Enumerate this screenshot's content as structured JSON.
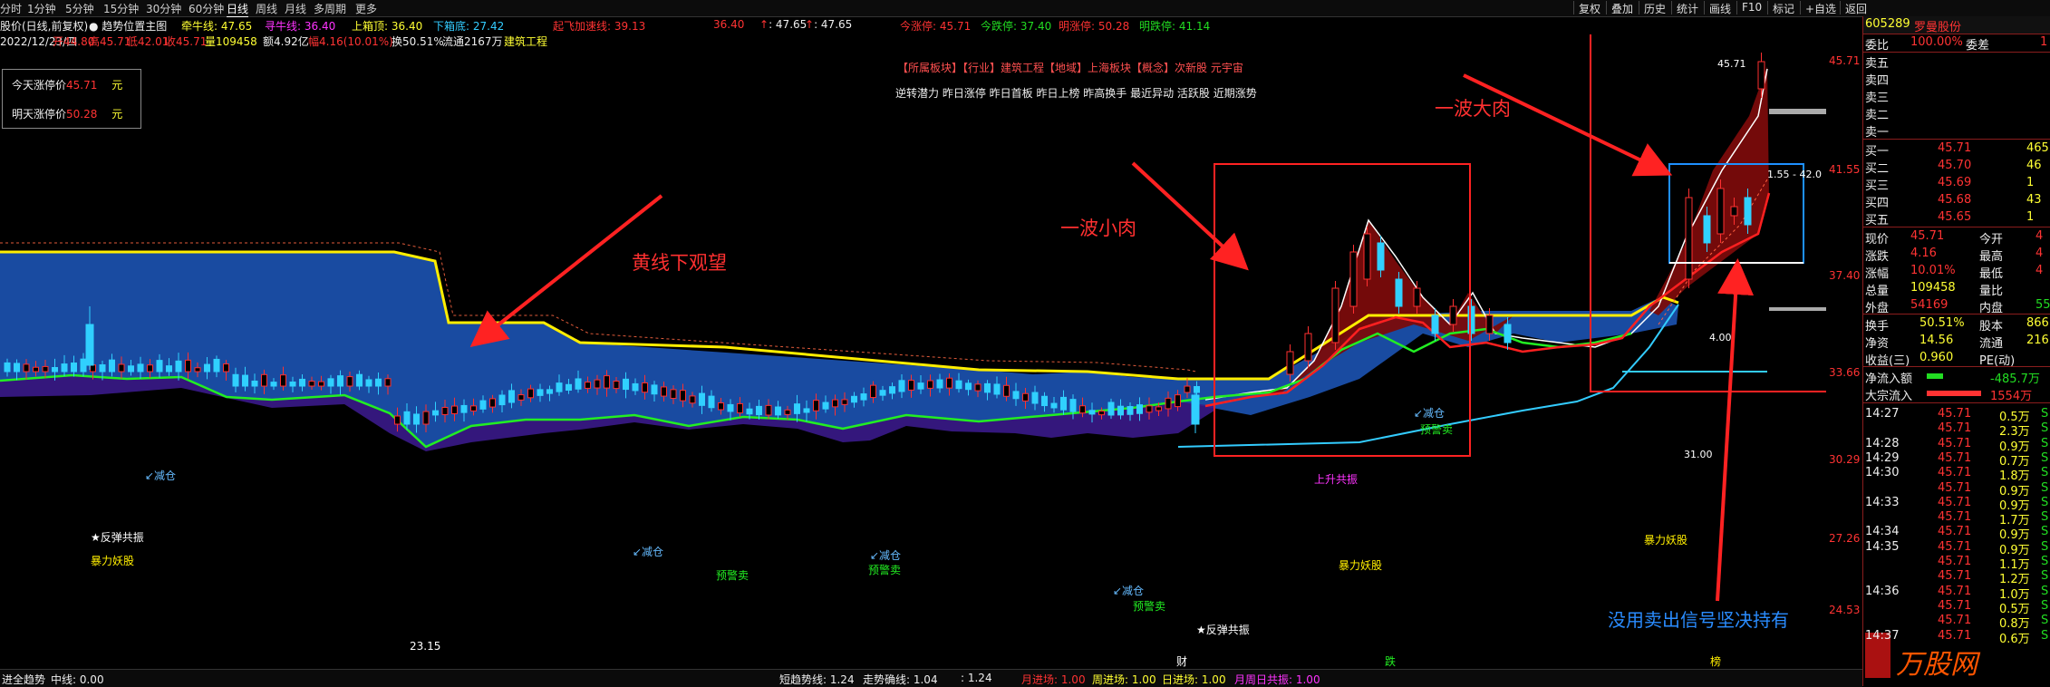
{
  "toolbar": {
    "timeframes": [
      "分时",
      "1分钟",
      "5分钟",
      "15分钟",
      "30分钟",
      "60分钟",
      "日线",
      "周线",
      "月线",
      "多周期",
      "更多"
    ],
    "active_timeframe": "日线",
    "right_buttons": [
      "复权",
      "叠加",
      "历史",
      "统计",
      "画线",
      "F10",
      "标记",
      "+自选",
      "返回"
    ]
  },
  "indicator_line1": {
    "title": "股价(日线,前复权)",
    "sub": "趋势位置主图",
    "items": [
      {
        "label": "牵牛线: 47.65",
        "color": "#ffff33"
      },
      {
        "label": "寻牛线: 36.40",
        "color": "#ff33ff"
      },
      {
        "label": "上箱顶: 36.40",
        "color": "#ffff33"
      },
      {
        "label": "下箱底: 27.42",
        "color": "#33ccff"
      },
      {
        "label": "起飞加速线: 39.13",
        "color": "#ff3333"
      },
      {
        "label": "36.40",
        "color": "#ff3333"
      },
      {
        "label": ": 47.65",
        "color": "#eeeeee"
      },
      {
        "label": ": 47.65",
        "color": "#eeeeee"
      },
      {
        "label": "今涨停: 45.71",
        "color": "#ff3333"
      },
      {
        "label": "今跌停: 37.40",
        "color": "#22dd22"
      },
      {
        "label": "明涨停: 50.28",
        "color": "#ff3333"
      },
      {
        "label": "明跌停: 41.14",
        "color": "#22dd22"
      }
    ]
  },
  "indicator_line2": {
    "date": "2022/12/23/四",
    "open": "开44.80",
    "high": "高45.71",
    "low": "低42.01",
    "close": "收45.71",
    "volume": "量109458",
    "amount": "额4.92亿",
    "change": "幅4.16(10.01%)",
    "turnover": "换50.51%",
    "float": "流通2167万",
    "sector": "建筑工程"
  },
  "limit_box": {
    "today_label": "今天涨停价",
    "today_value": "45.71",
    "today_unit": "元",
    "tomorrow_label": "明天涨停价",
    "tomorrow_value": "50.28",
    "tomorrow_unit": "元"
  },
  "tags": {
    "line1": "【所属板块】【行业】建筑工程【地域】上海板块【概念】次新股 元宇宙",
    "line2": "逆转潜力 昨日涨停 昨日首板 昨日上榜 昨高换手 最近异动 活跃股 近期涨势"
  },
  "annotations": {
    "yellow_line": "黄线下观望",
    "small_wave": "一波小肉",
    "big_wave": "一波大肉",
    "hold": "没用卖出信号坚决持有",
    "reduce_labels": [
      "↙减仓",
      "↙减仓",
      "↙减仓",
      "↙减仓",
      "↙减仓"
    ],
    "warn_labels": [
      "预警卖",
      "预警卖",
      "预警卖",
      "预警卖"
    ],
    "rebound_labels": [
      "★反弹共振",
      "★反弹共振"
    ],
    "monster_labels": [
      "暴力妖股",
      "暴力妖股",
      "暴力妖股"
    ],
    "rise_label": "上升共振",
    "price_marks": {
      "p1": "23.15",
      "p2": "45.71",
      "p3": "4.00",
      "p4": "31.00",
      "p5": "1.55 - 42.0"
    },
    "bottom_marks": {
      "cai": "财",
      "die": "跌",
      "bang": "榜"
    }
  },
  "y_axis": [
    "45.71",
    "41.55",
    "37.40",
    "33.66",
    "30.29",
    "27.26",
    "24.53"
  ],
  "bottom_bar": [
    {
      "label": "进全趋势",
      "color": "#eeeeee"
    },
    {
      "label": "中线: 0.00",
      "color": "#eeeeee"
    },
    {
      "label": "短趋势线: 1.24",
      "color": "#eeeeee"
    },
    {
      "label": "走势确线: 1.04",
      "color": "#eeeeee"
    },
    {
      "label": ": 1.24",
      "color": "#eeeeee"
    },
    {
      "label": "月进场: 1.00",
      "color": "#ff3333"
    },
    {
      "label": "周进场: 1.00",
      "color": "#ffff33"
    },
    {
      "label": "日进场: 1.00",
      "color": "#ffff33"
    },
    {
      "label": "月周日共振: 1.00",
      "color": "#ff33ff"
    }
  ],
  "quote": {
    "code": "605289",
    "name": "罗曼股份",
    "weibi_label": "委比",
    "weibi_value": "100.00%",
    "weicha_label": "委差",
    "weicha_value": "1",
    "asks": [
      {
        "label": "卖五",
        "price": "",
        "vol": ""
      },
      {
        "label": "卖四",
        "price": "",
        "vol": ""
      },
      {
        "label": "卖三",
        "price": "",
        "vol": ""
      },
      {
        "label": "卖二",
        "price": "",
        "vol": ""
      },
      {
        "label": "卖一",
        "price": "",
        "vol": ""
      }
    ],
    "bids": [
      {
        "label": "买一",
        "price": "45.71",
        "vol": "465"
      },
      {
        "label": "买二",
        "price": "45.70",
        "vol": "46"
      },
      {
        "label": "买三",
        "price": "45.69",
        "vol": "1"
      },
      {
        "label": "买四",
        "price": "45.68",
        "vol": "43"
      },
      {
        "label": "买五",
        "price": "45.65",
        "vol": "1"
      }
    ],
    "stats": [
      {
        "l1": "现价",
        "v1": "45.71",
        "c1": "red",
        "l2": "今开",
        "v2": "4",
        "c2": "red"
      },
      {
        "l1": "涨跌",
        "v1": "4.16",
        "c1": "red",
        "l2": "最高",
        "v2": "4",
        "c2": "red"
      },
      {
        "l1": "涨幅",
        "v1": "10.01%",
        "c1": "red",
        "l2": "最低",
        "v2": "4",
        "c2": "red"
      },
      {
        "l1": "总量",
        "v1": "109458",
        "c1": "yellow",
        "l2": "量比",
        "v2": "",
        "c2": "yellow"
      },
      {
        "l1": "外盘",
        "v1": "54169",
        "c1": "red",
        "l2": "内盘",
        "v2": "55",
        "c2": "green"
      }
    ],
    "stats2": [
      {
        "l1": "换手",
        "v1": "50.51%",
        "l2": "股本",
        "v2": "866"
      },
      {
        "l1": "净资",
        "v1": "14.56",
        "l2": "流通",
        "v2": "216"
      },
      {
        "l1": "收益(三)",
        "v1": "0.960",
        "l2": "PE(动)",
        "v2": ""
      }
    ],
    "flow": [
      {
        "label": "净流入额",
        "value": "-485.7万",
        "color": "#22dd22"
      },
      {
        "label": "大宗流入",
        "value": "1554万",
        "color": "#ff3333"
      }
    ],
    "ticks": [
      {
        "t": "14:27",
        "p": "45.71",
        "v": "0.5万",
        "s": "S"
      },
      {
        "t": "",
        "p": "45.71",
        "v": "2.3万",
        "s": "S"
      },
      {
        "t": "14:28",
        "p": "45.71",
        "v": "0.9万",
        "s": "S"
      },
      {
        "t": "14:29",
        "p": "45.71",
        "v": "0.7万",
        "s": "S"
      },
      {
        "t": "14:30",
        "p": "45.71",
        "v": "1.8万",
        "s": "S"
      },
      {
        "t": "",
        "p": "45.71",
        "v": "0.9万",
        "s": "S"
      },
      {
        "t": "14:33",
        "p": "45.71",
        "v": "0.9万",
        "s": "S"
      },
      {
        "t": "",
        "p": "45.71",
        "v": "1.7万",
        "s": "S"
      },
      {
        "t": "14:34",
        "p": "45.71",
        "v": "0.9万",
        "s": "S"
      },
      {
        "t": "14:35",
        "p": "45.71",
        "v": "0.9万",
        "s": "S"
      },
      {
        "t": "",
        "p": "45.71",
        "v": "1.1万",
        "s": "S"
      },
      {
        "t": "",
        "p": "45.71",
        "v": "1.2万",
        "s": "S"
      },
      {
        "t": "14:36",
        "p": "45.71",
        "v": "1.0万",
        "s": "S"
      },
      {
        "t": "",
        "p": "45.71",
        "v": "0.5万",
        "s": "S"
      },
      {
        "t": "",
        "p": "45.71",
        "v": "0.8万",
        "s": "S"
      },
      {
        "t": "14:37",
        "p": "45.71",
        "v": "0.6万",
        "s": "S"
      }
    ],
    "watermark": "万股网"
  }
}
